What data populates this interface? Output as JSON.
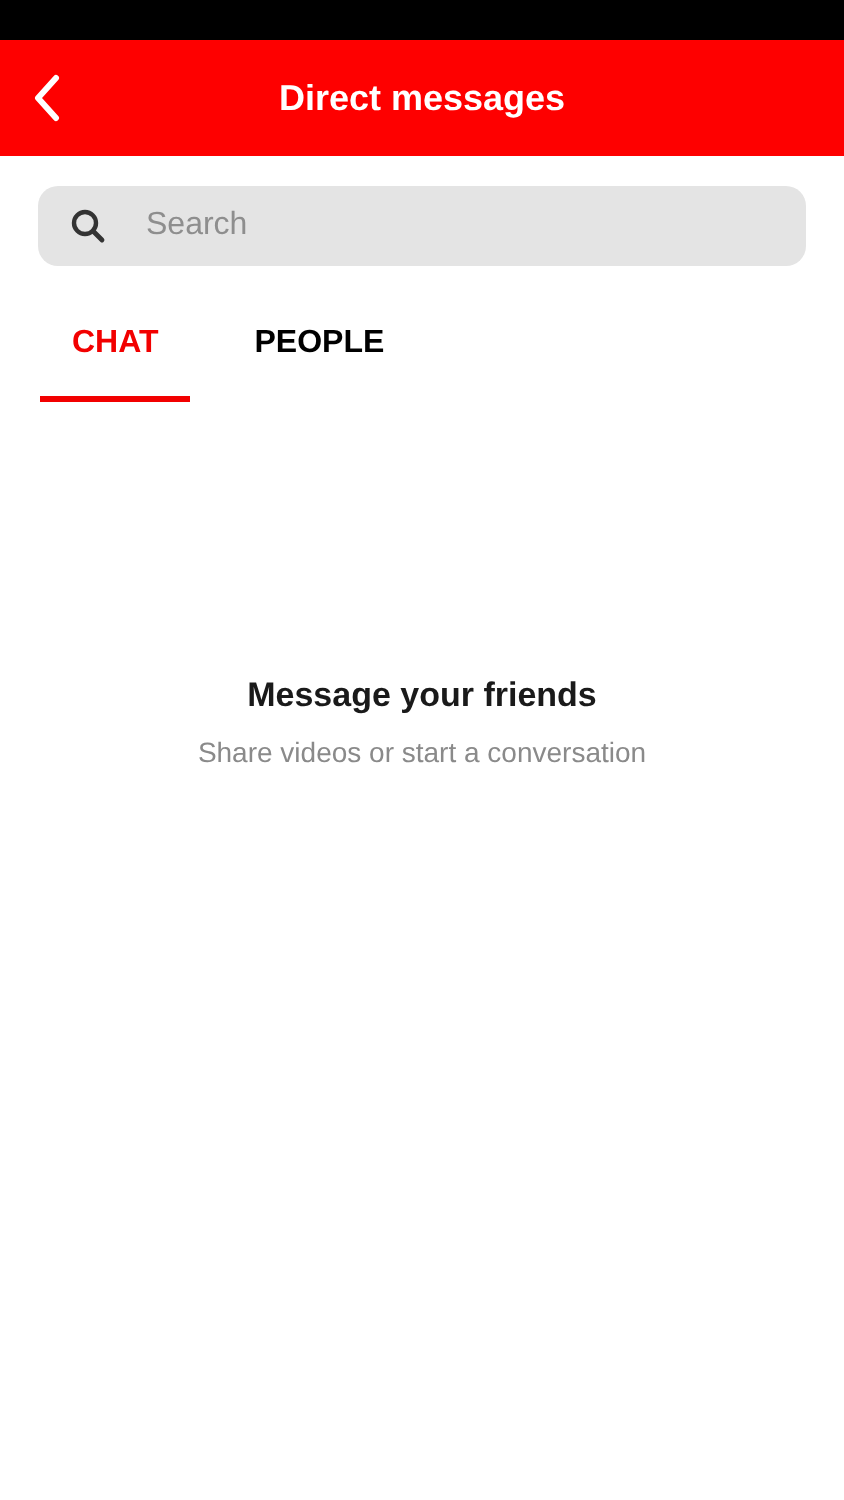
{
  "header": {
    "title": "Direct messages"
  },
  "search": {
    "placeholder": "Search"
  },
  "tabs": [
    {
      "label": "CHAT",
      "selected": true
    },
    {
      "label": "PEOPLE",
      "selected": false
    }
  ],
  "empty_state": {
    "title": "Message your friends",
    "subtitle": "Share videos or start a conversation"
  }
}
